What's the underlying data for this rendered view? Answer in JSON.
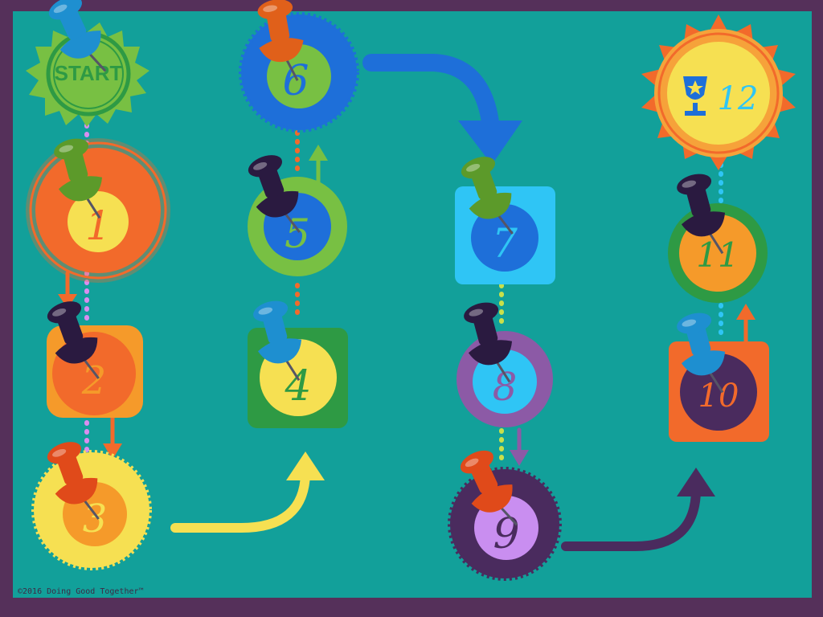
{
  "board": {
    "start_label": "START",
    "copyright": "©2016 Doing Good Together™",
    "spaces": [
      "1",
      "2",
      "3",
      "4",
      "5",
      "6",
      "7",
      "8",
      "9",
      "10",
      "11",
      "12"
    ],
    "final_icon": "trophy-icon",
    "pin_icon": "pushpin-icon"
  },
  "colors": {
    "background": "#12a09a",
    "border": "#55305a",
    "orange": "#f26a2b",
    "yellow": "#f6e052",
    "green": "#78c043",
    "blue": "#1e6fd9",
    "light_blue": "#2fc5f5",
    "purple": "#8c5aa6",
    "dark_purple": "#4a2b5e"
  }
}
